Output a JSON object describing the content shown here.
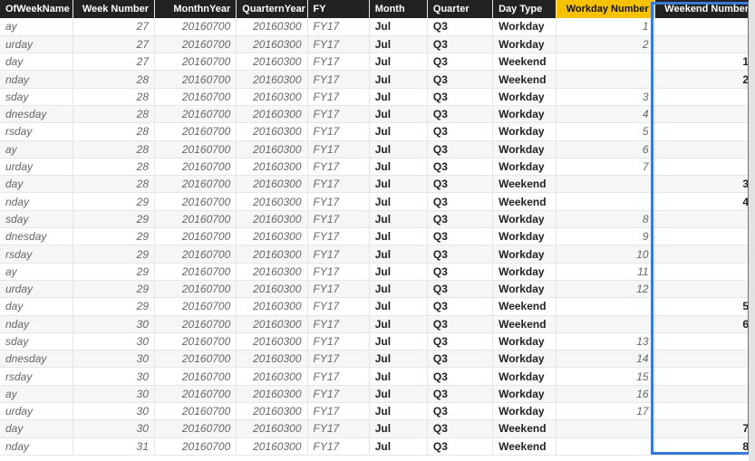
{
  "columns": [
    {
      "key": "dayOfWeekName",
      "label": "OfWeekName",
      "align": "left",
      "bold": false,
      "highlight": false
    },
    {
      "key": "weekNumber",
      "label": "Week Number",
      "align": "right",
      "bold": false,
      "highlight": false
    },
    {
      "key": "monthnYear",
      "label": "MonthnYear",
      "align": "right",
      "bold": false,
      "highlight": false
    },
    {
      "key": "quarternYear",
      "label": "QuarternYear",
      "align": "right",
      "bold": false,
      "highlight": false
    },
    {
      "key": "fy",
      "label": "FY",
      "align": "left",
      "bold": false,
      "highlight": false
    },
    {
      "key": "month",
      "label": "Month",
      "align": "left",
      "bold": true,
      "highlight": false
    },
    {
      "key": "quarter",
      "label": "Quarter",
      "align": "left",
      "bold": true,
      "highlight": false
    },
    {
      "key": "dayType",
      "label": "Day Type",
      "align": "left",
      "bold": true,
      "highlight": false
    },
    {
      "key": "workdayNumber",
      "label": "Workday Number",
      "align": "right",
      "bold": false,
      "highlight": true
    },
    {
      "key": "weekendNumber",
      "label": "Weekend Number",
      "align": "right",
      "bold": true,
      "highlight": false
    }
  ],
  "rows": [
    {
      "dayOfWeekName": "ay",
      "weekNumber": 27,
      "monthnYear": 20160700,
      "quarternYear": 20160300,
      "fy": "FY17",
      "month": "Jul",
      "quarter": "Q3",
      "dayType": "Workday",
      "workdayNumber": 1,
      "weekendNumber": ""
    },
    {
      "dayOfWeekName": "urday",
      "weekNumber": 27,
      "monthnYear": 20160700,
      "quarternYear": 20160300,
      "fy": "FY17",
      "month": "Jul",
      "quarter": "Q3",
      "dayType": "Workday",
      "workdayNumber": 2,
      "weekendNumber": ""
    },
    {
      "dayOfWeekName": "day",
      "weekNumber": 27,
      "monthnYear": 20160700,
      "quarternYear": 20160300,
      "fy": "FY17",
      "month": "Jul",
      "quarter": "Q3",
      "dayType": "Weekend",
      "workdayNumber": "",
      "weekendNumber": 1
    },
    {
      "dayOfWeekName": "nday",
      "weekNumber": 28,
      "monthnYear": 20160700,
      "quarternYear": 20160300,
      "fy": "FY17",
      "month": "Jul",
      "quarter": "Q3",
      "dayType": "Weekend",
      "workdayNumber": "",
      "weekendNumber": 2
    },
    {
      "dayOfWeekName": "sday",
      "weekNumber": 28,
      "monthnYear": 20160700,
      "quarternYear": 20160300,
      "fy": "FY17",
      "month": "Jul",
      "quarter": "Q3",
      "dayType": "Workday",
      "workdayNumber": 3,
      "weekendNumber": ""
    },
    {
      "dayOfWeekName": "dnesday",
      "weekNumber": 28,
      "monthnYear": 20160700,
      "quarternYear": 20160300,
      "fy": "FY17",
      "month": "Jul",
      "quarter": "Q3",
      "dayType": "Workday",
      "workdayNumber": 4,
      "weekendNumber": ""
    },
    {
      "dayOfWeekName": "rsday",
      "weekNumber": 28,
      "monthnYear": 20160700,
      "quarternYear": 20160300,
      "fy": "FY17",
      "month": "Jul",
      "quarter": "Q3",
      "dayType": "Workday",
      "workdayNumber": 5,
      "weekendNumber": ""
    },
    {
      "dayOfWeekName": "ay",
      "weekNumber": 28,
      "monthnYear": 20160700,
      "quarternYear": 20160300,
      "fy": "FY17",
      "month": "Jul",
      "quarter": "Q3",
      "dayType": "Workday",
      "workdayNumber": 6,
      "weekendNumber": ""
    },
    {
      "dayOfWeekName": "urday",
      "weekNumber": 28,
      "monthnYear": 20160700,
      "quarternYear": 20160300,
      "fy": "FY17",
      "month": "Jul",
      "quarter": "Q3",
      "dayType": "Workday",
      "workdayNumber": 7,
      "weekendNumber": ""
    },
    {
      "dayOfWeekName": "day",
      "weekNumber": 28,
      "monthnYear": 20160700,
      "quarternYear": 20160300,
      "fy": "FY17",
      "month": "Jul",
      "quarter": "Q3",
      "dayType": "Weekend",
      "workdayNumber": "",
      "weekendNumber": 3
    },
    {
      "dayOfWeekName": "nday",
      "weekNumber": 29,
      "monthnYear": 20160700,
      "quarternYear": 20160300,
      "fy": "FY17",
      "month": "Jul",
      "quarter": "Q3",
      "dayType": "Weekend",
      "workdayNumber": "",
      "weekendNumber": 4
    },
    {
      "dayOfWeekName": "sday",
      "weekNumber": 29,
      "monthnYear": 20160700,
      "quarternYear": 20160300,
      "fy": "FY17",
      "month": "Jul",
      "quarter": "Q3",
      "dayType": "Workday",
      "workdayNumber": 8,
      "weekendNumber": ""
    },
    {
      "dayOfWeekName": "dnesday",
      "weekNumber": 29,
      "monthnYear": 20160700,
      "quarternYear": 20160300,
      "fy": "FY17",
      "month": "Jul",
      "quarter": "Q3",
      "dayType": "Workday",
      "workdayNumber": 9,
      "weekendNumber": ""
    },
    {
      "dayOfWeekName": "rsday",
      "weekNumber": 29,
      "monthnYear": 20160700,
      "quarternYear": 20160300,
      "fy": "FY17",
      "month": "Jul",
      "quarter": "Q3",
      "dayType": "Workday",
      "workdayNumber": 10,
      "weekendNumber": ""
    },
    {
      "dayOfWeekName": "ay",
      "weekNumber": 29,
      "monthnYear": 20160700,
      "quarternYear": 20160300,
      "fy": "FY17",
      "month": "Jul",
      "quarter": "Q3",
      "dayType": "Workday",
      "workdayNumber": 11,
      "weekendNumber": ""
    },
    {
      "dayOfWeekName": "urday",
      "weekNumber": 29,
      "monthnYear": 20160700,
      "quarternYear": 20160300,
      "fy": "FY17",
      "month": "Jul",
      "quarter": "Q3",
      "dayType": "Workday",
      "workdayNumber": 12,
      "weekendNumber": ""
    },
    {
      "dayOfWeekName": "day",
      "weekNumber": 29,
      "monthnYear": 20160700,
      "quarternYear": 20160300,
      "fy": "FY17",
      "month": "Jul",
      "quarter": "Q3",
      "dayType": "Weekend",
      "workdayNumber": "",
      "weekendNumber": 5
    },
    {
      "dayOfWeekName": "nday",
      "weekNumber": 30,
      "monthnYear": 20160700,
      "quarternYear": 20160300,
      "fy": "FY17",
      "month": "Jul",
      "quarter": "Q3",
      "dayType": "Weekend",
      "workdayNumber": "",
      "weekendNumber": 6
    },
    {
      "dayOfWeekName": "sday",
      "weekNumber": 30,
      "monthnYear": 20160700,
      "quarternYear": 20160300,
      "fy": "FY17",
      "month": "Jul",
      "quarter": "Q3",
      "dayType": "Workday",
      "workdayNumber": 13,
      "weekendNumber": ""
    },
    {
      "dayOfWeekName": "dnesday",
      "weekNumber": 30,
      "monthnYear": 20160700,
      "quarternYear": 20160300,
      "fy": "FY17",
      "month": "Jul",
      "quarter": "Q3",
      "dayType": "Workday",
      "workdayNumber": 14,
      "weekendNumber": ""
    },
    {
      "dayOfWeekName": "rsday",
      "weekNumber": 30,
      "monthnYear": 20160700,
      "quarternYear": 20160300,
      "fy": "FY17",
      "month": "Jul",
      "quarter": "Q3",
      "dayType": "Workday",
      "workdayNumber": 15,
      "weekendNumber": ""
    },
    {
      "dayOfWeekName": "ay",
      "weekNumber": 30,
      "monthnYear": 20160700,
      "quarternYear": 20160300,
      "fy": "FY17",
      "month": "Jul",
      "quarter": "Q3",
      "dayType": "Workday",
      "workdayNumber": 16,
      "weekendNumber": ""
    },
    {
      "dayOfWeekName": "urday",
      "weekNumber": 30,
      "monthnYear": 20160700,
      "quarternYear": 20160300,
      "fy": "FY17",
      "month": "Jul",
      "quarter": "Q3",
      "dayType": "Workday",
      "workdayNumber": 17,
      "weekendNumber": ""
    },
    {
      "dayOfWeekName": "day",
      "weekNumber": 30,
      "monthnYear": 20160700,
      "quarternYear": 20160300,
      "fy": "FY17",
      "month": "Jul",
      "quarter": "Q3",
      "dayType": "Weekend",
      "workdayNumber": "",
      "weekendNumber": 7
    },
    {
      "dayOfWeekName": "nday",
      "weekNumber": 31,
      "monthnYear": 20160700,
      "quarternYear": 20160300,
      "fy": "FY17",
      "month": "Jul",
      "quarter": "Q3",
      "dayType": "Weekend",
      "workdayNumber": "",
      "weekendNumber": 8
    }
  ],
  "selectedColumnKey": "weekendNumber",
  "highlightedColumnKey": "workdayNumber"
}
